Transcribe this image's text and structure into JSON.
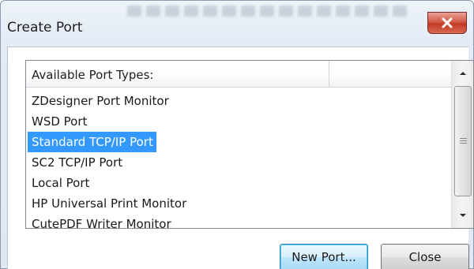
{
  "window": {
    "title": "Create Port"
  },
  "port_list": {
    "header": "Available Port Types:",
    "items": [
      {
        "label": "ZDesigner Port Monitor",
        "selected": false
      },
      {
        "label": "WSD Port",
        "selected": false
      },
      {
        "label": "Standard TCP/IP Port",
        "selected": true
      },
      {
        "label": "SC2 TCP/IP Port",
        "selected": false
      },
      {
        "label": "Local Port",
        "selected": false
      },
      {
        "label": "HP Universal Print Monitor",
        "selected": false
      },
      {
        "label": "CutePDF Writer Monitor",
        "selected": false
      }
    ]
  },
  "buttons": {
    "new_port": "New Port...",
    "close": "Close"
  },
  "colors": {
    "selection": "#3399ff",
    "close_button": "#c23a26",
    "default_button_border": "#3c7fb1"
  }
}
